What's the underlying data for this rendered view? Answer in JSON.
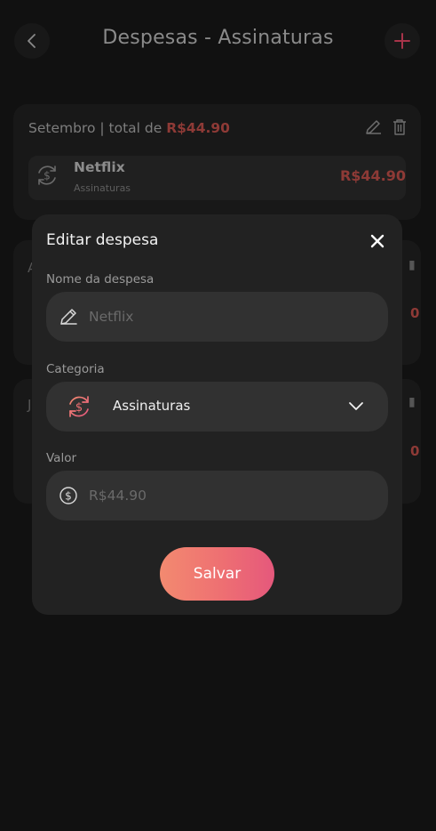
{
  "header": {
    "title": "Despesas - Assinaturas",
    "back_icon": "chevron-left-icon",
    "add_icon": "plus-icon"
  },
  "months": [
    {
      "label": "Setembro | total de ",
      "total": "R$44.90",
      "expenses": [
        {
          "name": "Netflix",
          "category": "Assinaturas",
          "value": "R$44.90"
        }
      ]
    },
    {
      "label_peek": "A",
      "value_peek": "0"
    },
    {
      "label_peek": "J",
      "value_peek": "0"
    }
  ],
  "modal": {
    "title": "Editar despesa",
    "name_label": "Nome da despesa",
    "name_placeholder": "Netflix",
    "category_label": "Categoria",
    "category_value": "Assinaturas",
    "value_label": "Valor",
    "value_placeholder": "R$44.90",
    "save_label": "Salvar"
  },
  "colors": {
    "accent": "#ee6f72",
    "accent_start": "#f38a70",
    "accent_end": "#e5587c",
    "dim_red": "#8e3a36",
    "background": "#111111",
    "modal": "#222222",
    "field": "#313131"
  }
}
